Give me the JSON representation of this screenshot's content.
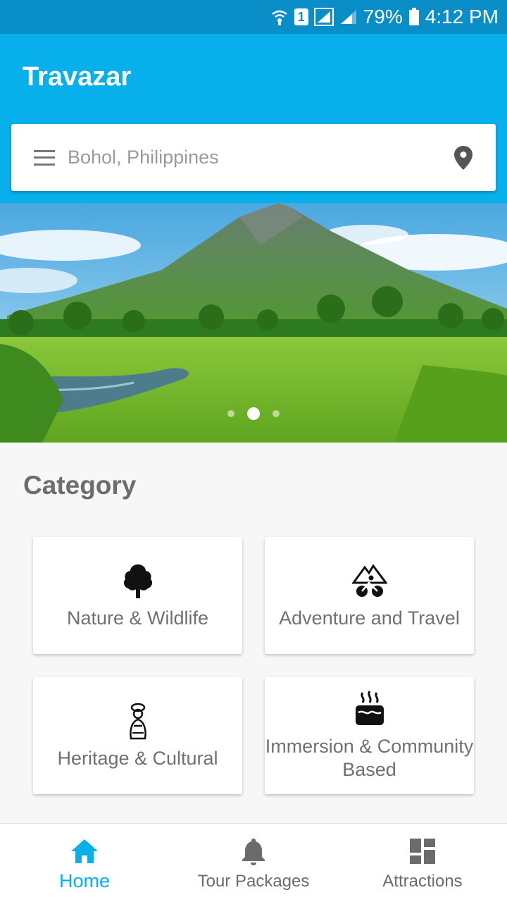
{
  "status_bar": {
    "battery": "79%",
    "time": "4:12 PM",
    "sim": "1",
    "icons": [
      "wifi-calling-icon",
      "sim-icon",
      "signal-icon",
      "signal-icon",
      "battery-icon"
    ]
  },
  "app_bar": {
    "title": "Travazar",
    "color": "#07b0ea"
  },
  "search": {
    "value": "Bohol, Philippines",
    "menu_icon": "menu-icon",
    "location_icon": "location-pin-icon"
  },
  "hero": {
    "image": "mayon-volcano-landscape",
    "slides": 3,
    "active_slide": 2
  },
  "category": {
    "title": "Category",
    "items": [
      {
        "label": "Nature & Wildlife",
        "icon": "tree-icon"
      },
      {
        "label": "Adventure and Travel",
        "icon": "mountain-bike-icon"
      },
      {
        "label": "Heritage & Cultural",
        "icon": "cultural-figure-icon"
      },
      {
        "label": "Immersion & Community Based",
        "icon": "hot-spring-icon"
      }
    ]
  },
  "bottom_nav": {
    "items": [
      {
        "label": "Home",
        "icon": "home-icon",
        "active": true
      },
      {
        "label": "Tour Packages",
        "icon": "bell-icon",
        "active": false
      },
      {
        "label": "Attractions",
        "icon": "dashboard-icon",
        "active": false
      }
    ],
    "active_color": "#07b0ea"
  }
}
